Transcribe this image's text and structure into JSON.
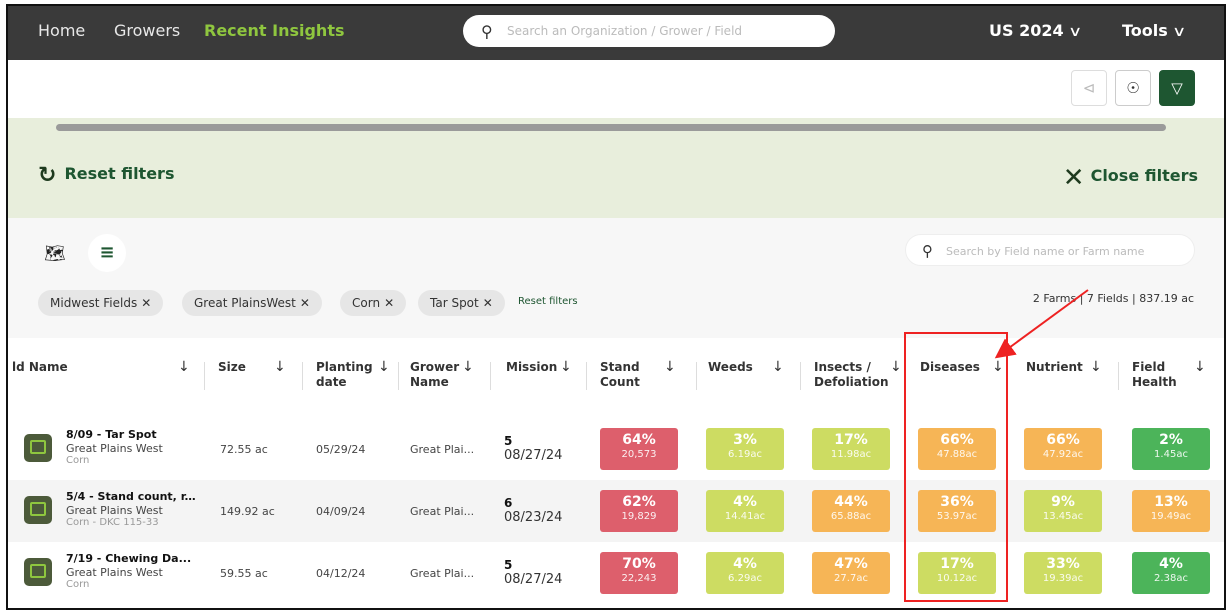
{
  "nav": {
    "home": "Home",
    "growers": "Growers",
    "recent_insights": "Recent Insights",
    "search_placeholder": "Search an Organization / Grower / Field",
    "season": "US 2024",
    "tools": "Tools"
  },
  "filters": {
    "reset_label": "Reset filters",
    "close_label": "Close filters"
  },
  "list": {
    "search_placeholder": "Search by Field name or Farm name",
    "chips": [
      "Midwest Fields",
      "Great PlainsWest",
      "Corn",
      "Tar Spot"
    ],
    "reset_chips": "Reset filters",
    "summary": "2 Farms | 7 Fields | 837.19 ac"
  },
  "table": {
    "headers": {
      "field_name": "ld Name",
      "size": "Size",
      "planting_date": [
        "Planting",
        "date"
      ],
      "grower_name": [
        "Grower",
        "Name"
      ],
      "mission": "Mission",
      "stand_count": [
        "Stand",
        "Count"
      ],
      "weeds": "Weeds",
      "insects": [
        "Insects /",
        "Defoliation"
      ],
      "diseases": "Diseases",
      "nutrient": "Nutrient",
      "field_health": [
        "Field",
        "Health"
      ]
    },
    "rows": [
      {
        "name": "8/09 - Tar Spot",
        "farm": "Great Plains West",
        "crop": "Corn",
        "size": "72.55 ac",
        "planting": "05/29/24",
        "grower": "Great Plai...",
        "mission_num": "5",
        "mission_date": "08/27/24",
        "stand": {
          "pct": "64%",
          "sub": "20,573",
          "color": "#dd5f6c"
        },
        "weeds": {
          "pct": "3%",
          "sub": "6.19ac",
          "color": "#cddc62"
        },
        "insects": {
          "pct": "17%",
          "sub": "11.98ac",
          "color": "#cddc62"
        },
        "diseases": {
          "pct": "66%",
          "sub": "47.88ac",
          "color": "#f6b556"
        },
        "nutrient": {
          "pct": "66%",
          "sub": "47.92ac",
          "color": "#f6b556"
        },
        "health": {
          "pct": "2%",
          "sub": "1.45ac",
          "color": "#4cb45a"
        }
      },
      {
        "name": "5/4 - Stand count, r...",
        "farm": "Great Plains West",
        "crop": "Corn - DKC 115-33",
        "size": "149.92 ac",
        "planting": "04/09/24",
        "grower": "Great Plai...",
        "mission_num": "6",
        "mission_date": "08/23/24",
        "stand": {
          "pct": "62%",
          "sub": "19,829",
          "color": "#dd5f6c"
        },
        "weeds": {
          "pct": "4%",
          "sub": "14.41ac",
          "color": "#cddc62"
        },
        "insects": {
          "pct": "44%",
          "sub": "65.88ac",
          "color": "#f6b556"
        },
        "diseases": {
          "pct": "36%",
          "sub": "53.97ac",
          "color": "#f6b556"
        },
        "nutrient": {
          "pct": "9%",
          "sub": "13.45ac",
          "color": "#cddc62"
        },
        "health": {
          "pct": "13%",
          "sub": "19.49ac",
          "color": "#f6b556"
        }
      },
      {
        "name": "7/19 - Chewing Da...",
        "farm": "Great Plains West",
        "crop": "Corn",
        "size": "59.55 ac",
        "planting": "04/12/24",
        "grower": "Great Plai...",
        "mission_num": "5",
        "mission_date": "08/27/24",
        "stand": {
          "pct": "70%",
          "sub": "22,243",
          "color": "#dd5f6c"
        },
        "weeds": {
          "pct": "4%",
          "sub": "6.29ac",
          "color": "#cddc62"
        },
        "insects": {
          "pct": "47%",
          "sub": "27.7ac",
          "color": "#f6b556"
        },
        "diseases": {
          "pct": "17%",
          "sub": "10.12ac",
          "color": "#cddc62"
        },
        "nutrient": {
          "pct": "33%",
          "sub": "19.39ac",
          "color": "#cddc62"
        },
        "health": {
          "pct": "4%",
          "sub": "2.38ac",
          "color": "#4cb45a"
        }
      }
    ]
  }
}
